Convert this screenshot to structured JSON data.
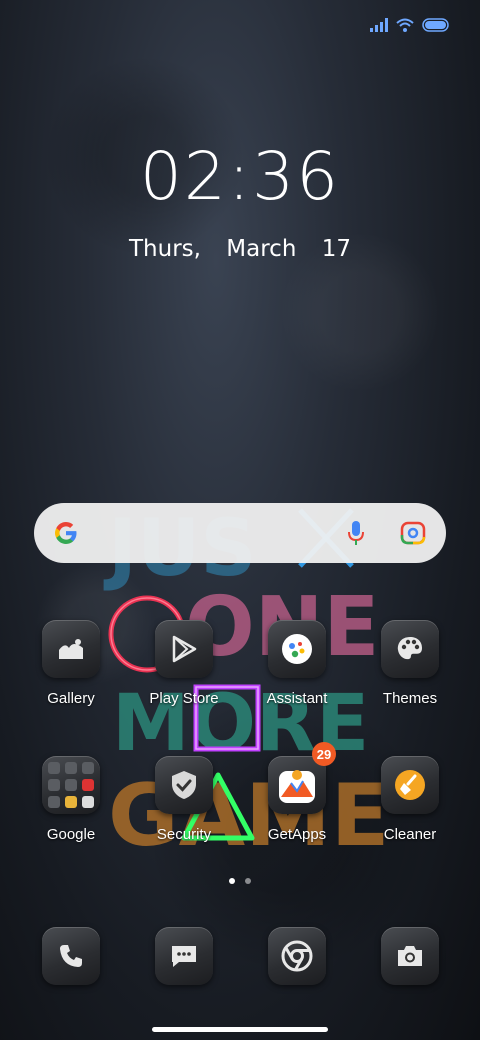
{
  "status": {
    "icons": [
      "signal-icon",
      "wifi-icon",
      "battery-icon"
    ]
  },
  "lockscreen": {
    "time": "02:36",
    "day": "Thurs,",
    "month": "March",
    "date_num": "17"
  },
  "search": {
    "icons": [
      "google-logo-icon",
      "microphone-icon",
      "google-lens-icon"
    ]
  },
  "apps": [
    {
      "label": "Gallery",
      "icon": "gallery-icon"
    },
    {
      "label": "Play Store",
      "icon": "play-store-icon"
    },
    {
      "label": "Assistant",
      "icon": "assistant-icon"
    },
    {
      "label": "Themes",
      "icon": "palette-icon"
    },
    {
      "label": "Google",
      "icon": "google-folder-icon"
    },
    {
      "label": "Security",
      "icon": "shield-icon"
    },
    {
      "label": "GetApps",
      "icon": "getapps-icon",
      "badge": "29"
    },
    {
      "label": "Cleaner",
      "icon": "broom-icon"
    }
  ],
  "dock": [
    {
      "icon": "phone-icon"
    },
    {
      "icon": "messages-icon"
    },
    {
      "icon": "chrome-icon"
    },
    {
      "icon": "camera-icon"
    }
  ],
  "pages": {
    "count": 2,
    "active": 1
  },
  "wallpaper": {
    "text": "JUST ONE MORE GAME"
  },
  "colors": {
    "badge": "#f15a24",
    "search_bg": "#f0f0f0",
    "neon_red": "#ff3355",
    "neon_purple": "#c040ff",
    "neon_green": "#33ff66",
    "neon_blue": "#33aaff"
  }
}
